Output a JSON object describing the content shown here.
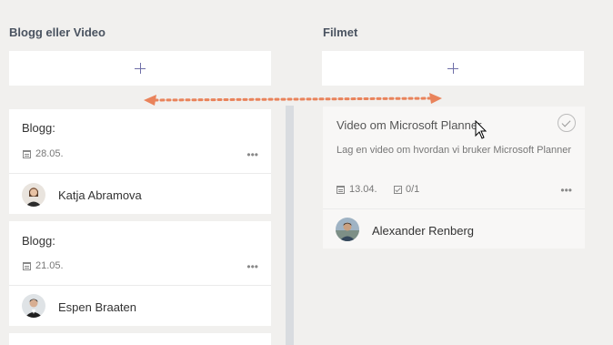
{
  "columns": [
    {
      "title": "Blogg eller Video",
      "cards": [
        {
          "title": "Blogg:",
          "date": "28.05.",
          "more": "•••",
          "assignee": "Katja Abramova"
        },
        {
          "title": "Blogg:",
          "date": "21.05.",
          "more": "•••",
          "assignee": "Espen Braaten"
        }
      ]
    },
    {
      "title": "Filmet",
      "cards": [
        {
          "title": "Video om Microsoft Planner",
          "description": "Lag en video om hvordan vi bruker Microsoft Planner",
          "date": "13.04.",
          "checklist": "0/1",
          "more": "•••",
          "assignee": "Alexander Renberg",
          "completed": true
        }
      ]
    }
  ],
  "icons": {
    "add": "plus-icon",
    "due_date": "calendar-icon",
    "checklist": "checkbox-icon",
    "complete": "checkmark-circle-icon",
    "more": "ellipsis-icon"
  },
  "annotation": {
    "arrow_color": "#e9835b"
  },
  "colors": {
    "board_bg": "#f1f0ee",
    "plus": "#6f6fa8"
  }
}
